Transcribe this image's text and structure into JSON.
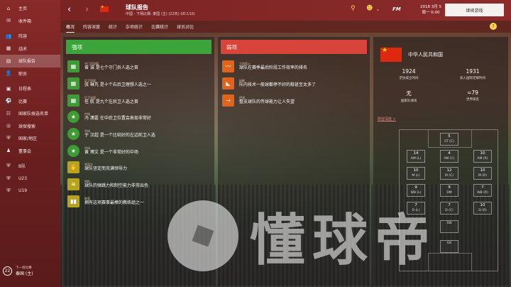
{
  "sidebar": {
    "items": [
      {
        "label": "主页",
        "icon": "home-icon",
        "glyph": "⌂"
      },
      {
        "label": "收件箱",
        "icon": "inbox-icon",
        "glyph": "✉"
      },
      {
        "label": "阵容",
        "icon": "squad-icon",
        "glyph": "👥"
      },
      {
        "label": "战术",
        "icon": "tactics-icon",
        "glyph": "▦"
      },
      {
        "label": "球队报告",
        "icon": "report-icon",
        "glyph": "▤"
      },
      {
        "label": "职员",
        "icon": "staff-icon",
        "glyph": "👤"
      },
      {
        "label": "日程表",
        "icon": "calendar-icon",
        "glyph": "▣"
      },
      {
        "label": "比赛",
        "icon": "match-icon",
        "glyph": "⚽"
      },
      {
        "label": "国家队候选名单",
        "icon": "shortlist-icon",
        "glyph": "☷"
      },
      {
        "label": "球探搜索",
        "icon": "scouting-icon",
        "glyph": "◎"
      },
      {
        "label": "国家/地区",
        "icon": "nation-icon",
        "glyph": "⛨"
      },
      {
        "label": "董事会",
        "icon": "board-icon",
        "glyph": "♟"
      },
      {
        "label": "B队",
        "icon": "b-team-icon",
        "glyph": "⛨"
      },
      {
        "label": "U23",
        "icon": "u23-icon",
        "glyph": "⛨"
      },
      {
        "label": "U19",
        "icon": "u19-icon",
        "glyph": "⛨"
      }
    ],
    "footer": {
      "number": "22",
      "small": "下一场比赛",
      "label": "泰国 (主)"
    }
  },
  "topbar": {
    "title": "球队报告",
    "subtitle": "中国 - 下场比赛: 泰国 (主) (22天) (ID:110)",
    "date_line1": "2018 3月 5",
    "date_line2": "周一 0:00",
    "continue_label": "继续游戏",
    "fm_label": "FM"
  },
  "tabs": [
    "概况",
    "阵容深度",
    "统计",
    "杂项统计",
    "比赛统计",
    "球员对比"
  ],
  "strengths": {
    "header": "强项",
    "items": [
      {
        "cat": "守门员深度",
        "desc": "曾 诚 是七个守门员人选之首",
        "icon": "grid-icon",
        "glyph": "▦",
        "style": "b-green"
      },
      {
        "cat": "后卫深度",
        "desc": "张 琳芃 是十个右后卫理想人选之一",
        "icon": "grid-icon",
        "glyph": "▦",
        "style": "b-green"
      },
      {
        "cat": "后卫深度",
        "desc": "任 航 是九个左后卫人选之首",
        "icon": "grid-icon",
        "glyph": "▦",
        "style": "b-green"
      },
      {
        "cat": "中场",
        "desc": "冯 潇霆 在中后卫位置会表现非常好",
        "icon": "star-icon",
        "glyph": "★",
        "style": "b-green-r"
      },
      {
        "cat": "中场",
        "desc": "于 汉超 是一个比较好的左边前卫人选",
        "icon": "star-icon",
        "glyph": "★",
        "style": "b-green-r"
      },
      {
        "cat": "中场",
        "desc": "黄 博文 是一个非常好的中场",
        "icon": "star-icon",
        "glyph": "★",
        "style": "b-green-r"
      },
      {
        "cat": "领导力",
        "desc": "球队坚定而充满领导力",
        "icon": "leadership-icon",
        "glyph": "✋",
        "style": "b-yellow"
      },
      {
        "cat": "韧性",
        "desc": "球队的弹跳力和制空能力非常出色",
        "icon": "spring-icon",
        "glyph": "≋",
        "style": "b-yellow"
      },
      {
        "cat": "阵容",
        "desc": "拥有这项赛事最棒的教练组之一",
        "icon": "staff-group-icon",
        "glyph": "▮▮",
        "style": "b-yellow"
      }
    ]
  },
  "weaknesses": {
    "header": "弱项",
    "items": [
      {
        "cat": "工作投入",
        "desc": "球队在赛季最后阶段工作效率的排名",
        "icon": "pulse-icon",
        "glyph": "〰",
        "style": "b-orange"
      },
      {
        "cat": "技能",
        "desc": "队内技术一般球都停不好的稳甚至太多了",
        "icon": "boot-icon",
        "glyph": "◣",
        "style": "b-orange"
      },
      {
        "cat": "传球",
        "desc": "整支球队的传球能力让人失望",
        "icon": "passing-icon",
        "glyph": "⇢",
        "style": "b-orange"
      }
    ]
  },
  "info": {
    "nation": "中华人民共和国",
    "stats": [
      {
        "value": "1924",
        "label": "足协成立时间"
      },
      {
        "value": "1931",
        "label": "加入国际足联时间"
      },
      {
        "value": "无",
        "label": "国家队球场"
      },
      {
        "value": "=79",
        "label": "世界排名"
      }
    ],
    "pitch_label": "阵容深度 >",
    "positions": [
      {
        "n": "5",
        "p": "ST (C)"
      },
      {
        "n": "14",
        "p": "AM (L)"
      },
      {
        "n": "4",
        "p": "AM (C)"
      },
      {
        "n": "10",
        "p": "AM (R)"
      },
      {
        "n": "10",
        "p": "M (L)"
      },
      {
        "n": "12",
        "p": "M (C)"
      },
      {
        "n": "10",
        "p": "M (R)"
      },
      {
        "n": "9",
        "p": "WB (L)"
      },
      {
        "n": "9",
        "p": "DM"
      },
      {
        "n": "7",
        "p": "WB (R)"
      },
      {
        "n": "7",
        "p": "D (L)"
      },
      {
        "n": "7",
        "p": "D (C)"
      },
      {
        "n": "10",
        "p": "D (R)"
      },
      {
        "n": "",
        "p": "SW"
      },
      {
        "n": "",
        "p": "GK"
      }
    ]
  },
  "watermark": "懂球帝",
  "colors": {
    "sidebar": "#7a2424",
    "strength": "#3ca43a",
    "weakness": "#d9443a"
  }
}
